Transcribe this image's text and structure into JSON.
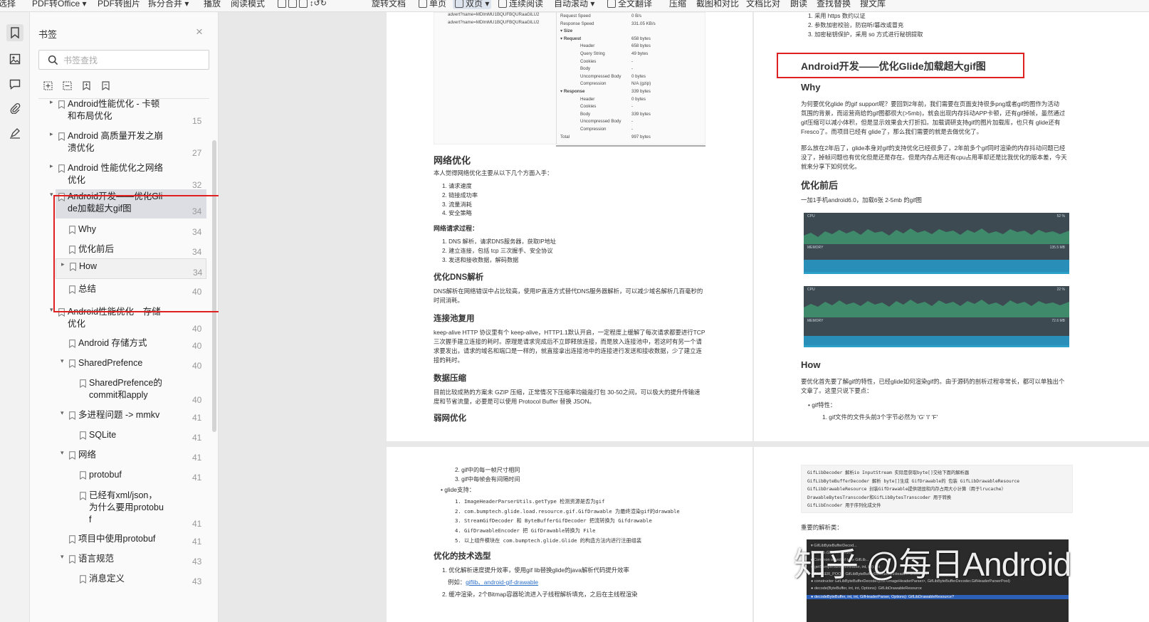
{
  "toolbar": {
    "items": [
      "选择",
      "PDF转Office ▾",
      "PDF转图片",
      "拆分合并 ▾",
      "播放",
      "阅读模式",
      "单页",
      "双页 ▾",
      "连续阅读",
      "自动滚动 ▾",
      "全文翻译",
      "压缩",
      "截图和对比",
      "文档比对",
      "朗读",
      "查找替换",
      "搜文库"
    ]
  },
  "rail": {
    "icons": [
      "bookmark-icon",
      "thumbnail-icon",
      "comment-icon",
      "attachment-icon",
      "signature-icon"
    ]
  },
  "panel": {
    "title": "书签",
    "search_placeholder": "书签查找",
    "bookmarks": [
      {
        "label": "Android性能优化 - 卡顿\n和布局优化",
        "page": "15"
      },
      {
        "label": "Android 高质量开发之崩\n溃优化",
        "page": "27"
      },
      {
        "label": "Android 性能优化之网络\n优化",
        "page": "32"
      },
      {
        "label": "Android开发——优化Gli\nde加载超大gif图",
        "page": "34"
      },
      {
        "label": "Why",
        "page": "34"
      },
      {
        "label": "优化前后",
        "page": "34"
      },
      {
        "label": "How",
        "page": "34"
      },
      {
        "label": "总结",
        "page": "40"
      },
      {
        "label": "Android性能优化—存储\n优化",
        "page": "40"
      },
      {
        "label": "Android 存储方式",
        "page": "40"
      },
      {
        "label": "SharedPrefence",
        "page": "40"
      },
      {
        "label": "SharedPrefence的\ncommit和apply",
        "page": "40"
      },
      {
        "label": "多进程问题 -> mmkv",
        "page": "41"
      },
      {
        "label": "SQLite",
        "page": "41"
      },
      {
        "label": "网络",
        "page": "41"
      },
      {
        "label": "protobuf",
        "page": "41"
      },
      {
        "label": "已经有xml/json，\n为什么要用protobu\nf",
        "page": "41"
      },
      {
        "label": "项目中使用protobuf",
        "page": "41"
      },
      {
        "label": "语言规范",
        "page": "43"
      },
      {
        "label": "消息定义",
        "page": "43"
      }
    ]
  },
  "page1": {
    "table_rows": [
      {
        "k": "Request Speed",
        "v": "0 B/s"
      },
      {
        "k": "Response Speed",
        "v": "331.05 KB/s"
      },
      {
        "k": "▾ Size",
        "v": ""
      },
      {
        "k": "▾ Request",
        "v": "658 bytes"
      },
      {
        "k": "Header",
        "v": "658 bytes"
      },
      {
        "k": "Query String",
        "v": "49 bytes"
      },
      {
        "k": "Cookies",
        "v": "-"
      },
      {
        "k": "Body",
        "v": "-"
      },
      {
        "k": "Uncompressed Body",
        "v": "0 bytes"
      },
      {
        "k": "Compression",
        "v": "N/A (gzip)"
      },
      {
        "k": "▾ Response",
        "v": "339 bytes"
      },
      {
        "k": "Header",
        "v": "0 bytes"
      },
      {
        "k": "Cookies",
        "v": "-"
      },
      {
        "k": "Body",
        "v": "339 bytes"
      },
      {
        "k": "Uncompressed Body",
        "v": "-"
      },
      {
        "k": "Compression",
        "v": "-"
      },
      {
        "k": "Total",
        "v": "997 bytes"
      }
    ],
    "table_left": [
      "advert?name=MDlmMU1BQUFBQURaaGlLU2",
      "advert?name=MDlmMU1BQUFBQURaaGlLU2"
    ],
    "h_network": "网络优化",
    "p_network": "本人觉得网络优化主要从以下几个方面入手：",
    "list_network": [
      "1. 请求速度",
      "2. 链接成功率",
      "3. 流量消耗",
      "4. 安全策略"
    ],
    "h_process": "网络请求过程：",
    "list_process": [
      "1. DNS 解析，请求DNS服务器，获取IP地址",
      "2. 建立连接，包括 tcp 三次握手、安全协议",
      "3. 发送和接收数据，解码数据"
    ],
    "h_dns": "优化DNS解析",
    "p_dns": [
      "DNS解析在网络错误中占比较高，使用IP直连方式替代DNS服务器解析，可以减少域名解析几百毫秒的",
      "时间消耗。"
    ],
    "h_pool": "连接池复用",
    "p_pool": [
      "keep-alive HTTP 协议里有个 keep-alive，HTTP1.1默认开启，一定程度上缓解了每次请求都要进行TCP",
      "三次握手建立连接的耗时。原理是请求完成后不立即释放连接，而是放入连接池中，若这时有另一个请",
      "求要发出，请求的域名和端口是一样的，就直接拿出连接池中的连接进行发送和接收数据，少了建立连",
      "接的耗时。"
    ],
    "h_compress": "数据压缩",
    "p_compress": [
      "目前比较成熟的方案未 GZIP 压缩，正常情况下压缩率均能能打包 30-50之间，可以极大的提升传输速",
      "度和节省流量，必要是可以使用 Protocol Buffer 替换 JSON。"
    ],
    "h_weak": "弱网优化"
  },
  "page2": {
    "top_list": [
      "1. 采用 https 数约以证",
      "2. 参数加密校验，防窃听/篡改或冒充",
      "3. 加密秘钥保护，采用 so 方式进行秘钥提取"
    ],
    "title": "Android开发——优化Glide加载超大gif图",
    "h_why": "Why",
    "p_why1": [
      "为何要优化glide 的gif support呢？要回到2年前，我们需要在页面支持很多png或者gif的图作为活动",
      "氛围的背景，而运营商给的gif图都很大(>5mb)，就会出现内存抖动APP卡顿，还有gif掉帧，虽然通过",
      "gif压缩可以减小体积，但是显示效果会大打折扣。加载调研支持gif的图片加载库，也只有 glide还有",
      "Fresco了。而项目已经有 glide了，那么我们需要的就是去做优化了。"
    ],
    "p_why2": [
      "那么放在2年后了，glide本身对gif的支持优化已经很多了，2年前多个gif同时渲染的内存抖动问题已经",
      "没了，掉帧问题也有优化但是还是存在。但是内存占用还有cpu占用率却还是比我优化的版本差，今天",
      "就来分享下如何优化。"
    ],
    "h_before": "优化前后",
    "p_before": "一加1手机android6.0，加载6张 2-5mb 的gif图",
    "chart_labels": [
      "CPU",
      "MEMORY",
      "52 %",
      "135.5 MB",
      "22 %",
      "72.6 MB"
    ],
    "h_how": "How",
    "p_how": [
      "要优化首先要了解gif的特性，已经glide如何渲染gif的。由于源码的剖析过程非常长，都可以单独出个",
      "文章了。这里只说下要点："
    ],
    "bullet_gif": "gif特性：",
    "sub_gif": "1. gif文件的文件头前3个字节必然为 'G' 'I' 'F'"
  },
  "page3": {
    "list_top": [
      "2. gif中的每一帧尺寸相同",
      "3. gif中每帧会有间隔时间"
    ],
    "bullet_glide": "glide支持：",
    "list_glide": [
      "1. ImageHeaderParserUtils.getType 检测资源是否为gif",
      "2. com.bumptech.glide.load.resource.gif.GifDrawable 为最终渲染gif的drawable",
      "3. StreamGifDecoder 和 ByteBufferGifDecoder 把流转换为 Gifdrawable",
      "4. GifDrawableEncoder 把 GifDrawable转换为 File",
      "5. 以上组件模块在 com.bumptech.glide.Glide 的构造方法内进行注册组装"
    ],
    "h_tech": "优化的技术选型",
    "list_tech1": "1. 优化解析速度提升效率，使用gif lib替换glide的java解析代码提升效率",
    "example": "例如：",
    "links": [
      "giflib、",
      "android-gif-drawable"
    ],
    "list_tech2": "2. 缓冲渲染，2个Bitmap容器轮流进入子线程解析填充，之后在主线程渲染"
  },
  "page4": {
    "code": [
      "GifLibDecoder  解析io InputStream 实际是获取byte[]交给下面的解析器",
      "GifLibByteBufferDecoder   解析 byte[]生成 GifDrawable的 包装 GifLibDrawableResource",
      "GifLibDrawableResource    封装GifDrawable提供销毁和内存占用大小计算（用于lrucache）",
      "DrawableBytesTranscoder和GifLibBytesTranscoder  用于转换",
      "GifLibEncoder             用于序列化成文件"
    ],
    "p_parsers": "重要的解析类：",
    "dark_rows": [
      "▾ GifLibByteBufferDecod...",
      "  Run: Lib.GifLibDecoder",
      "  ▸ Common object of type GifLib...",
      "  ● getSampleSize(GifHeader, int, int): int",
      "  ● PARSER_POOL: GifLibByteBufferDecoder.GifHeaderParserPool",
      "  ● constructor GifLibByteBufferDecoder(List<ImageHeaderParser>, GifLibByteBufferDecoder.GifHeaderParserPool)",
      "  ● decode(ByteBuffer, int, int, Options): GifLibDrawableResource",
      "  ● decodeByteBuffer, int, int, GifHeaderParser, Options): GifLibDrawableResource?"
    ]
  },
  "watermark": "知乎 @每日Android"
}
